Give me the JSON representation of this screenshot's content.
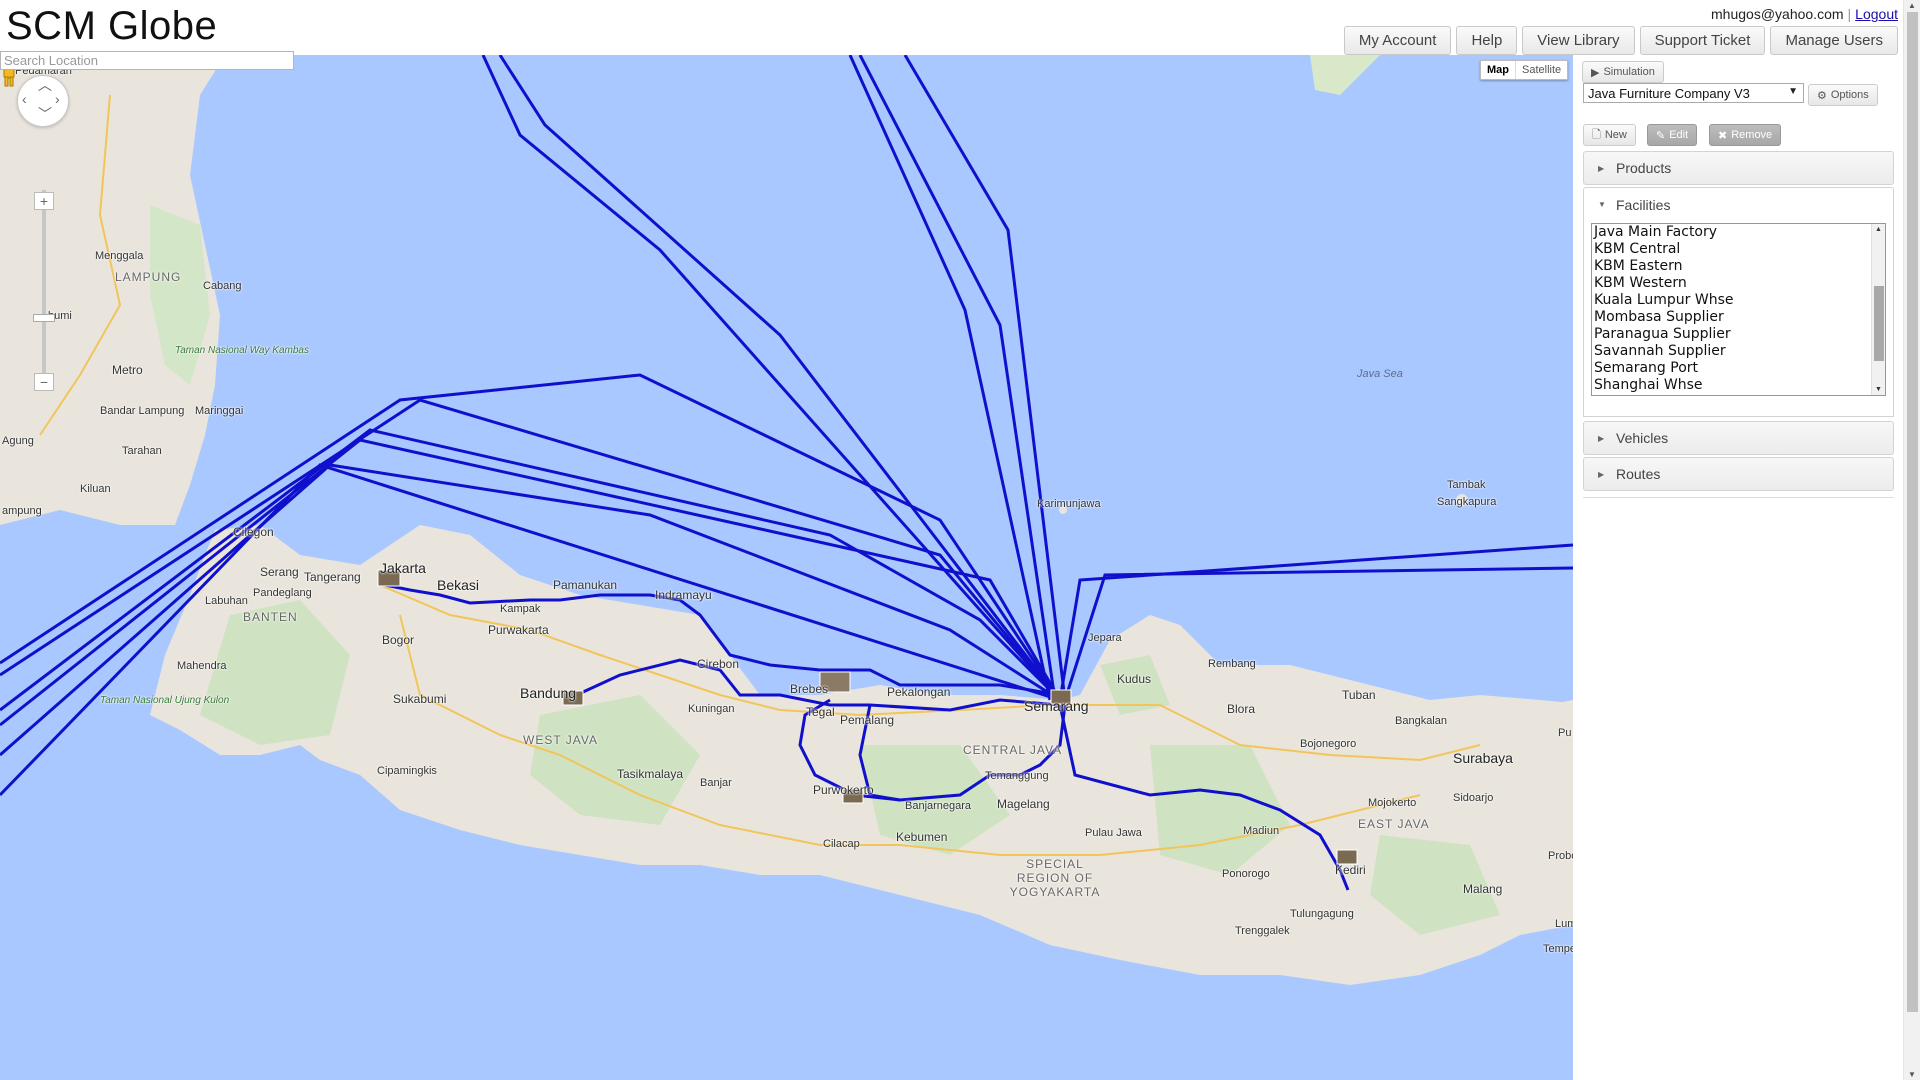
{
  "app": {
    "title": "SCM Globe"
  },
  "user": {
    "email": "mhugos@yahoo.com",
    "logout_label": "Logout"
  },
  "nav": {
    "my_account": "My Account",
    "help": "Help",
    "view_library": "View Library",
    "support_ticket": "Support Ticket",
    "manage_users": "Manage Users"
  },
  "search": {
    "placeholder": "Search Location",
    "value": ""
  },
  "map": {
    "type_map": "Map",
    "type_satellite": "Satellite",
    "active_type": "Map",
    "land_color": "#e9e5dc",
    "water_color": "#a9c8ff",
    "route_color": "#1010cc",
    "places": {
      "jakarta": "Jakarta",
      "bekasi": "Bekasi",
      "tangerang": "Tangerang",
      "serang": "Serang",
      "cilegon": "Cilegon",
      "bogor": "Bogor",
      "sukabumi": "Sukabumi",
      "bandung": "Bandung",
      "purwakarta": "Purwakarta",
      "pamanukan": "Pamanukan",
      "indramayu": "Indramayu",
      "cirebon": "Cirebon",
      "kuningan": "Kuningan",
      "tasikmalaya": "Tasikmalaya",
      "banjar": "Banjar",
      "brebes": "Brebes",
      "tegal": "Tegal",
      "pemalang": "Pemalang",
      "pekalongan": "Pekalongan",
      "semarang": "Semarang",
      "purwokerto": "Purwokerto",
      "banjarnegara": "Banjarnegara",
      "temanggung": "Temanggung",
      "magelang": "Magelang",
      "kebumen": "Kebumen",
      "cilacap": "Cilacap",
      "yogyakarta": "SPECIAL REGION OF YOGYAKARTA",
      "kudus": "Kudus",
      "jepara": "Jepara",
      "rembang": "Rembang",
      "blora": "Blora",
      "tuban": "Tuban",
      "bojonegoro": "Bojonegoro",
      "surabaya": "Surabaya",
      "sidoarjo": "Sidoarjo",
      "mojokerto": "Mojokerto",
      "madiun": "Madiun",
      "ponorogo": "Ponorogo",
      "kediri": "Kediri",
      "tulungagung": "Tulungagung",
      "trenggalek": "Trenggalek",
      "malang": "Malang",
      "bangkalan": "Bangkalan",
      "probolinggo": "Probolin",
      "lumajang": "Luma",
      "tempeh": "Tempe",
      "pu": "Pu",
      "karimunjawa": "Karimunjawa",
      "java_sea": "Java Sea",
      "tambak": "Tambak",
      "sangkapura": "Sangkapura",
      "west_java": "WEST JAVA",
      "central_java": "CENTRAL JAVA",
      "east_java": "EAST JAVA",
      "banten": "BANTEN",
      "lampung": "LAMPUNG",
      "pandeglang": "Pandeglang",
      "labuhan": "Labuhan",
      "mahendra": "Mahendra",
      "cipamingkis": "Cipamingkis",
      "pulau_jawa": "Pulau Jawa",
      "ujung_kulon": "Taman Nasional Ujung Kulon",
      "way_kambas": "Taman Nasional Way Kambas",
      "menggala": "Menggala",
      "cabang": "Cabang",
      "bumi": "bumi",
      "metro": "Metro",
      "bandar_lampung": "Bandar Lampung",
      "maringgai": "Maringgai",
      "tarahan": "Tarahan",
      "kiluan": "Kiluan",
      "agung": "Agung",
      "kampung": "ampung",
      "pedamaran": "Pedamaran",
      "kampak": "Kampak"
    }
  },
  "sidebar": {
    "simulation_label": "Simulation",
    "company": "Java Furniture Company V3",
    "options_label": "Options",
    "new_label": "New",
    "edit_label": "Edit",
    "remove_label": "Remove",
    "sections": {
      "products": "Products",
      "facilities": "Facilities",
      "vehicles": "Vehicles",
      "routes": "Routes"
    },
    "facilities": [
      "Java Main Factory",
      "KBM Central",
      "KBM Eastern",
      "KBM Western",
      "Kuala Lumpur Whse",
      "Mombasa Supplier",
      "Paranagua Supplier",
      "Savannah Supplier",
      "Semarang Port",
      "Shanghai Whse"
    ]
  }
}
